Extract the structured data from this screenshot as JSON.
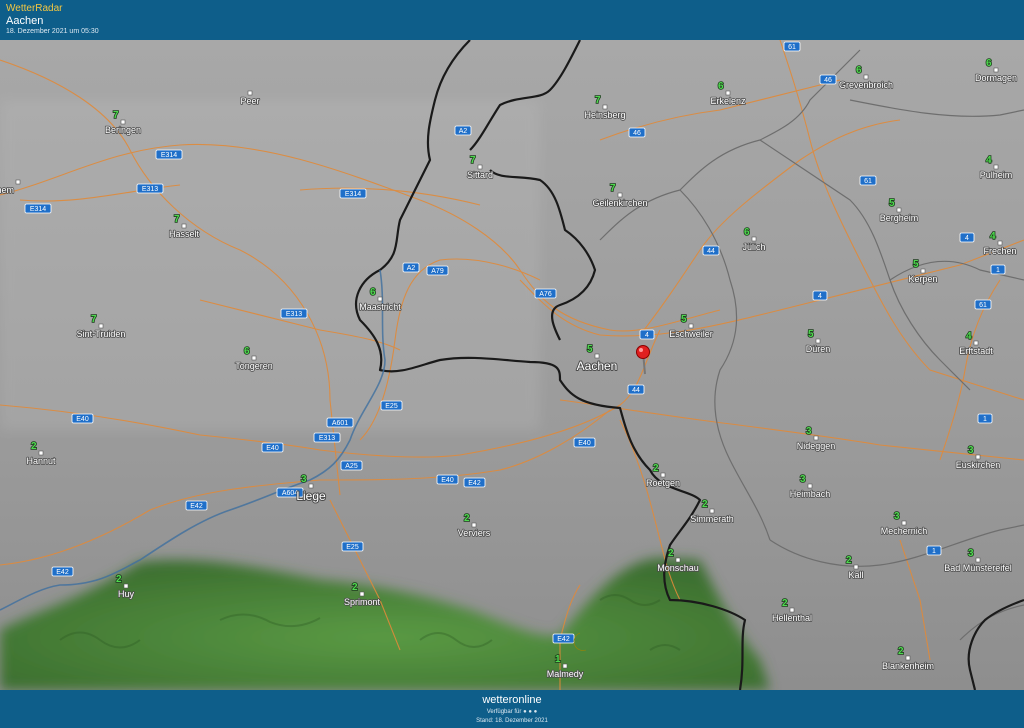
{
  "header": {
    "brand": "WetterRadar",
    "location": "Aachen",
    "timestamp": "18. Dezember 2021 um 05:30"
  },
  "footer": {
    "logo": "wetteronline",
    "availability": "Verfügbar für",
    "stand": "Stand: 18. Dezember 2021"
  },
  "colors": {
    "header_bg": "#0e5e8a",
    "brand_text": "#f3c742",
    "temperature_text": "#4fd84f",
    "roads": "#e08a3a",
    "national_border": "#1a1a1a",
    "regional_border": "#6e6e6e",
    "river": "#3f6f9f",
    "forest_radar": "#4f8a3a",
    "location_pin": "#e02020",
    "moon": "#f5d020"
  },
  "icons": [
    "location-pin-icon",
    "moon-icon"
  ],
  "map": {
    "selected_location": "Aachen",
    "cities": [
      {
        "name": "Peer",
        "value": ""
      },
      {
        "name": "Beringen",
        "value": "7"
      },
      {
        "name": "-Zichem",
        "value": ""
      },
      {
        "name": "Hasselt",
        "value": "7"
      },
      {
        "name": "Sint-Truiden",
        "value": "7"
      },
      {
        "name": "Tongeren",
        "value": "6"
      },
      {
        "name": "Hannut",
        "value": "2"
      },
      {
        "name": "Huy",
        "value": "2"
      },
      {
        "name": "Liege",
        "value": "3"
      },
      {
        "name": "Sprimont",
        "value": "2"
      },
      {
        "name": "Verviers",
        "value": "2"
      },
      {
        "name": "Maastricht",
        "value": "6"
      },
      {
        "name": "Sittard",
        "value": "7"
      },
      {
        "name": "Heinsberg",
        "value": "7"
      },
      {
        "name": "Geilenkirchen",
        "value": "7"
      },
      {
        "name": "Erkelenz",
        "value": "6"
      },
      {
        "name": "Grevenbroich",
        "value": "6"
      },
      {
        "name": "Dormagen",
        "value": "6"
      },
      {
        "name": "Pulheim",
        "value": "4"
      },
      {
        "name": "Bergheim",
        "value": "5"
      },
      {
        "name": "Jülich",
        "value": "6"
      },
      {
        "name": "Frechen",
        "value": "4"
      },
      {
        "name": "Kerpen",
        "value": "5"
      },
      {
        "name": "Erftstadt",
        "value": "4"
      },
      {
        "name": "Aachen",
        "value": "5"
      },
      {
        "name": "Eschweiler",
        "value": "5"
      },
      {
        "name": "Düren",
        "value": "5"
      },
      {
        "name": "Nideggen",
        "value": "3"
      },
      {
        "name": "Euskirchen",
        "value": "3"
      },
      {
        "name": "Roetgen",
        "value": "2"
      },
      {
        "name": "Heimbach",
        "value": "3"
      },
      {
        "name": "Simmerath",
        "value": "2"
      },
      {
        "name": "Mechernich",
        "value": "3"
      },
      {
        "name": "Monschau",
        "value": "2"
      },
      {
        "name": "Kall",
        "value": "2"
      },
      {
        "name": "Bad Münstereifel",
        "value": "3"
      },
      {
        "name": "Hellenthal",
        "value": "2"
      },
      {
        "name": "Blankenheim",
        "value": "2"
      },
      {
        "name": "Malmedy",
        "value": "1"
      }
    ],
    "road_labels": [
      "61",
      "46",
      "A2",
      "46",
      "E314",
      "E313",
      "E314",
      "E314",
      "61",
      "44",
      "4",
      "1",
      "A2",
      "A79",
      "A76",
      "E313",
      "4",
      "61",
      "4",
      "44",
      "E25",
      "A601",
      "E40",
      "E40",
      "E313",
      "A25",
      "E40",
      "E40",
      "1",
      "E42",
      "A604",
      "E42",
      "E42",
      "E25",
      "1",
      "E42"
    ]
  }
}
